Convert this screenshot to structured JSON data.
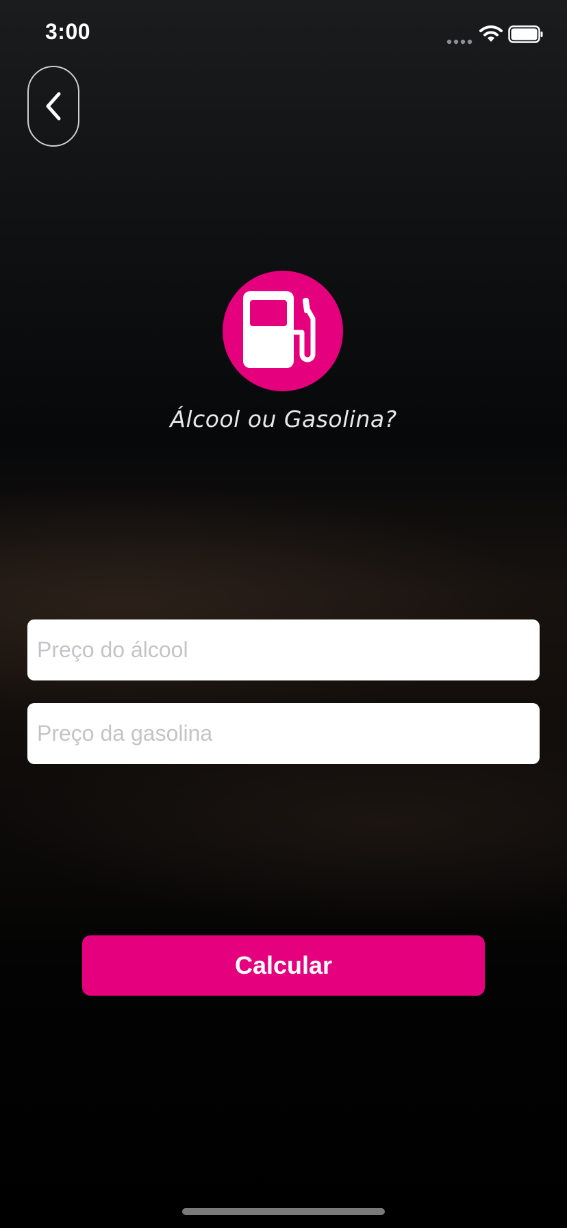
{
  "status_bar": {
    "time": "3:00",
    "icons": [
      "cellular-signal-icon",
      "wifi-icon",
      "battery-icon"
    ]
  },
  "nav": {
    "back_icon": "chevron-left-icon"
  },
  "logo": {
    "icon": "fuel-pump-icon",
    "title": "Álcool ou Gasolina?"
  },
  "form": {
    "alcool_placeholder": "Preço do álcool",
    "alcool_value": "",
    "gasolina_placeholder": "Preço da gasolina",
    "gasolina_value": ""
  },
  "actions": {
    "calculate_label": "Calcular"
  },
  "colors": {
    "accent": "#e5007e",
    "background": "#0b0b0c",
    "field_background": "#ffffff",
    "placeholder": "#c4c4c8"
  }
}
